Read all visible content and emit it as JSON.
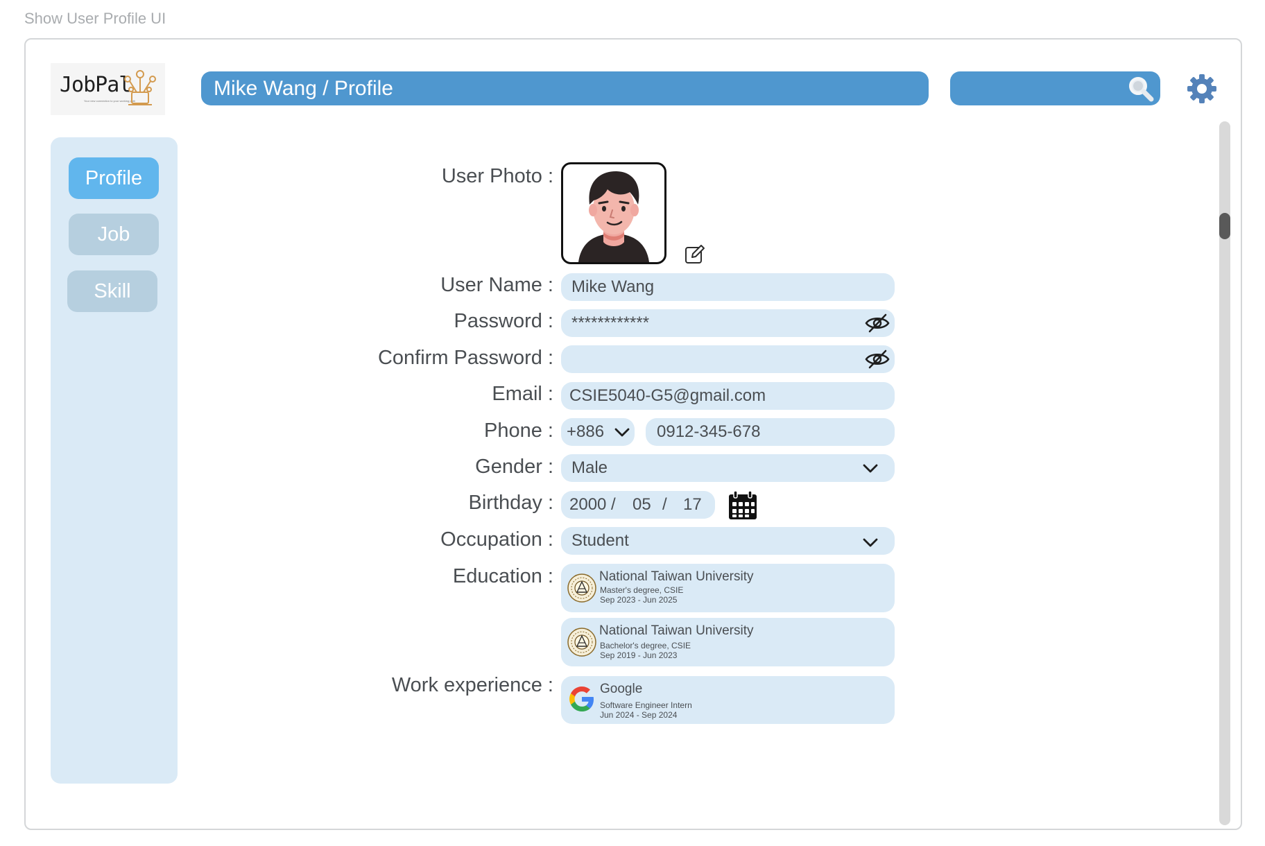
{
  "frame": {
    "title": "Show User Profile UI"
  },
  "logo": {
    "name": "JobPal",
    "tagline": "Your new connection to your working path"
  },
  "header": {
    "breadcrumb": "Mike Wang / Profile",
    "search_placeholder": ""
  },
  "sidebar": {
    "items": [
      {
        "label": "Profile",
        "active": true
      },
      {
        "label": "Job",
        "active": false
      },
      {
        "label": "Skill",
        "active": false
      }
    ]
  },
  "form": {
    "labels": {
      "photo": "User Photo :",
      "name": "User Name :",
      "password": "Password :",
      "confirm": "Confirm Password :",
      "email": "Email :",
      "phone": "Phone :",
      "gender": "Gender :",
      "birthday": "Birthday :",
      "occupation": "Occupation :",
      "education": "Education :",
      "work": "Work experience :"
    },
    "values": {
      "name": "Mike Wang",
      "password": "************",
      "confirm": "",
      "email": "CSIE5040-G5@gmail.com",
      "phone_code": "+886",
      "phone": "0912-345-678",
      "gender": "Male",
      "birth_year": "2000",
      "birth_month": "05",
      "birth_day": "17",
      "birth_sep": "/",
      "occupation": "Student"
    },
    "education": [
      {
        "school": "National Taiwan University",
        "degree": "Master's degree, CSIE",
        "period": "Sep 2023 - Jun 2025"
      },
      {
        "school": "National Taiwan University",
        "degree": "Bachelor's degree, CSIE",
        "period": "Sep 2019 - Jun 2023"
      }
    ],
    "work": [
      {
        "company": "Google",
        "role": "Software Engineer Intern",
        "period": "Jun 2024 - Sep 2024"
      }
    ]
  },
  "colors": {
    "accent": "#4f97cf",
    "active_tab": "#61b6ed",
    "inactive_tab": "#b6cfdf",
    "field_bg": "#daeaf6"
  },
  "icons": [
    "search-icon",
    "gear-icon",
    "edit-icon",
    "eye-off-icon",
    "chevron-down-icon",
    "calendar-icon",
    "ntu-seal-icon",
    "google-g-icon"
  ]
}
